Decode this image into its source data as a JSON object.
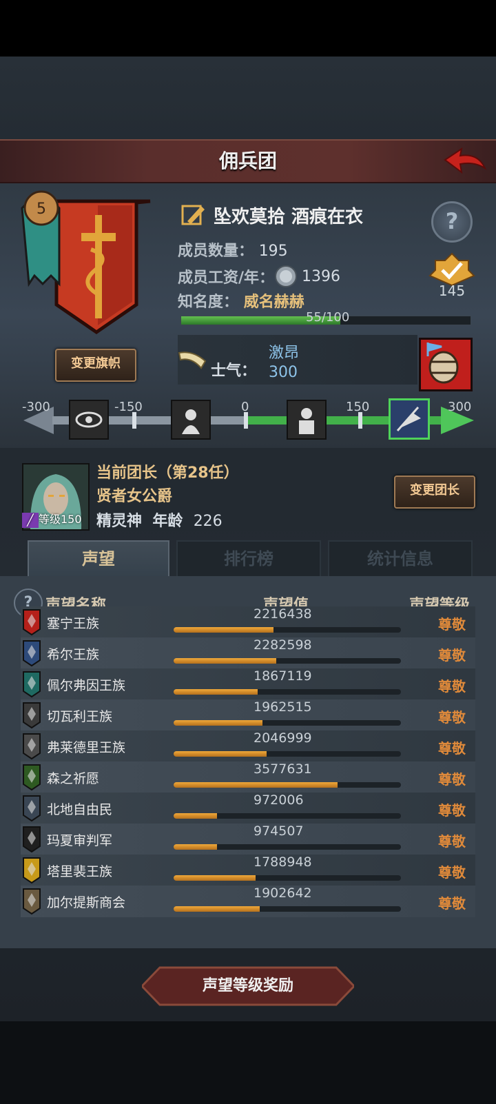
{
  "header": {
    "title": "佣兵团"
  },
  "guild": {
    "name": "坠欢莫拾 酒痕在衣",
    "members_label": "成员数量：",
    "members_value": "195",
    "salary_label": "成员工资/年：",
    "salary_value": "1396",
    "fame_label": "知名度：",
    "fame_value": "威名赫赫",
    "fame_progress": "55/100",
    "fame_fraction": 0.55,
    "change_flag_label": "变更旗帜",
    "rank_value": "145",
    "help_glyph": "?"
  },
  "morale": {
    "label": "士气：",
    "state": "激昂",
    "value": "300",
    "ticks": [
      "-300",
      "-150",
      "0",
      "150",
      "300"
    ]
  },
  "leader": {
    "title": "当前团长（第28任）",
    "name": "贤者女公爵",
    "race": "精灵神",
    "age_label": "年龄",
    "age_value": "226",
    "level_label": "等级150",
    "change_leader_label": "变更团长"
  },
  "tabs": [
    {
      "label": "声望"
    },
    {
      "label": "排行榜"
    },
    {
      "label": "统计信息"
    }
  ],
  "table": {
    "help_glyph": "?",
    "headers": {
      "name": "声望名称",
      "value": "声望值",
      "level": "声望等级"
    },
    "rows": [
      {
        "name": "塞宁王族",
        "value": "2216438",
        "level": "尊敬",
        "fill": 0.44,
        "color": "#b5201a"
      },
      {
        "name": "希尔王族",
        "value": "2282598",
        "level": "尊敬",
        "fill": 0.45,
        "color": "#2d4a7a"
      },
      {
        "name": "佩尔弗因王族",
        "value": "1867119",
        "level": "尊敬",
        "fill": 0.37,
        "color": "#1f6a62"
      },
      {
        "name": "切瓦利王族",
        "value": "1962515",
        "level": "尊敬",
        "fill": 0.39,
        "color": "#3a3a3a"
      },
      {
        "name": "弗莱德里王族",
        "value": "2046999",
        "level": "尊敬",
        "fill": 0.41,
        "color": "#4a4a4a"
      },
      {
        "name": "森之祈愿",
        "value": "3577631",
        "level": "尊敬",
        "fill": 0.72,
        "color": "#2e5a22"
      },
      {
        "name": "北地自由民",
        "value": "972006",
        "level": "尊敬",
        "fill": 0.19,
        "color": "#3a4654"
      },
      {
        "name": "玛夏审判军",
        "value": "974507",
        "level": "尊敬",
        "fill": 0.19,
        "color": "#1f1f1f"
      },
      {
        "name": "塔里裴王族",
        "value": "1788948",
        "level": "尊敬",
        "fill": 0.36,
        "color": "#c79a1a"
      },
      {
        "name": "加尔提斯商会",
        "value": "1902642",
        "level": "尊敬",
        "fill": 0.38,
        "color": "#6a5a40"
      }
    ]
  },
  "reward_button": {
    "label": "声望等级奖励"
  }
}
